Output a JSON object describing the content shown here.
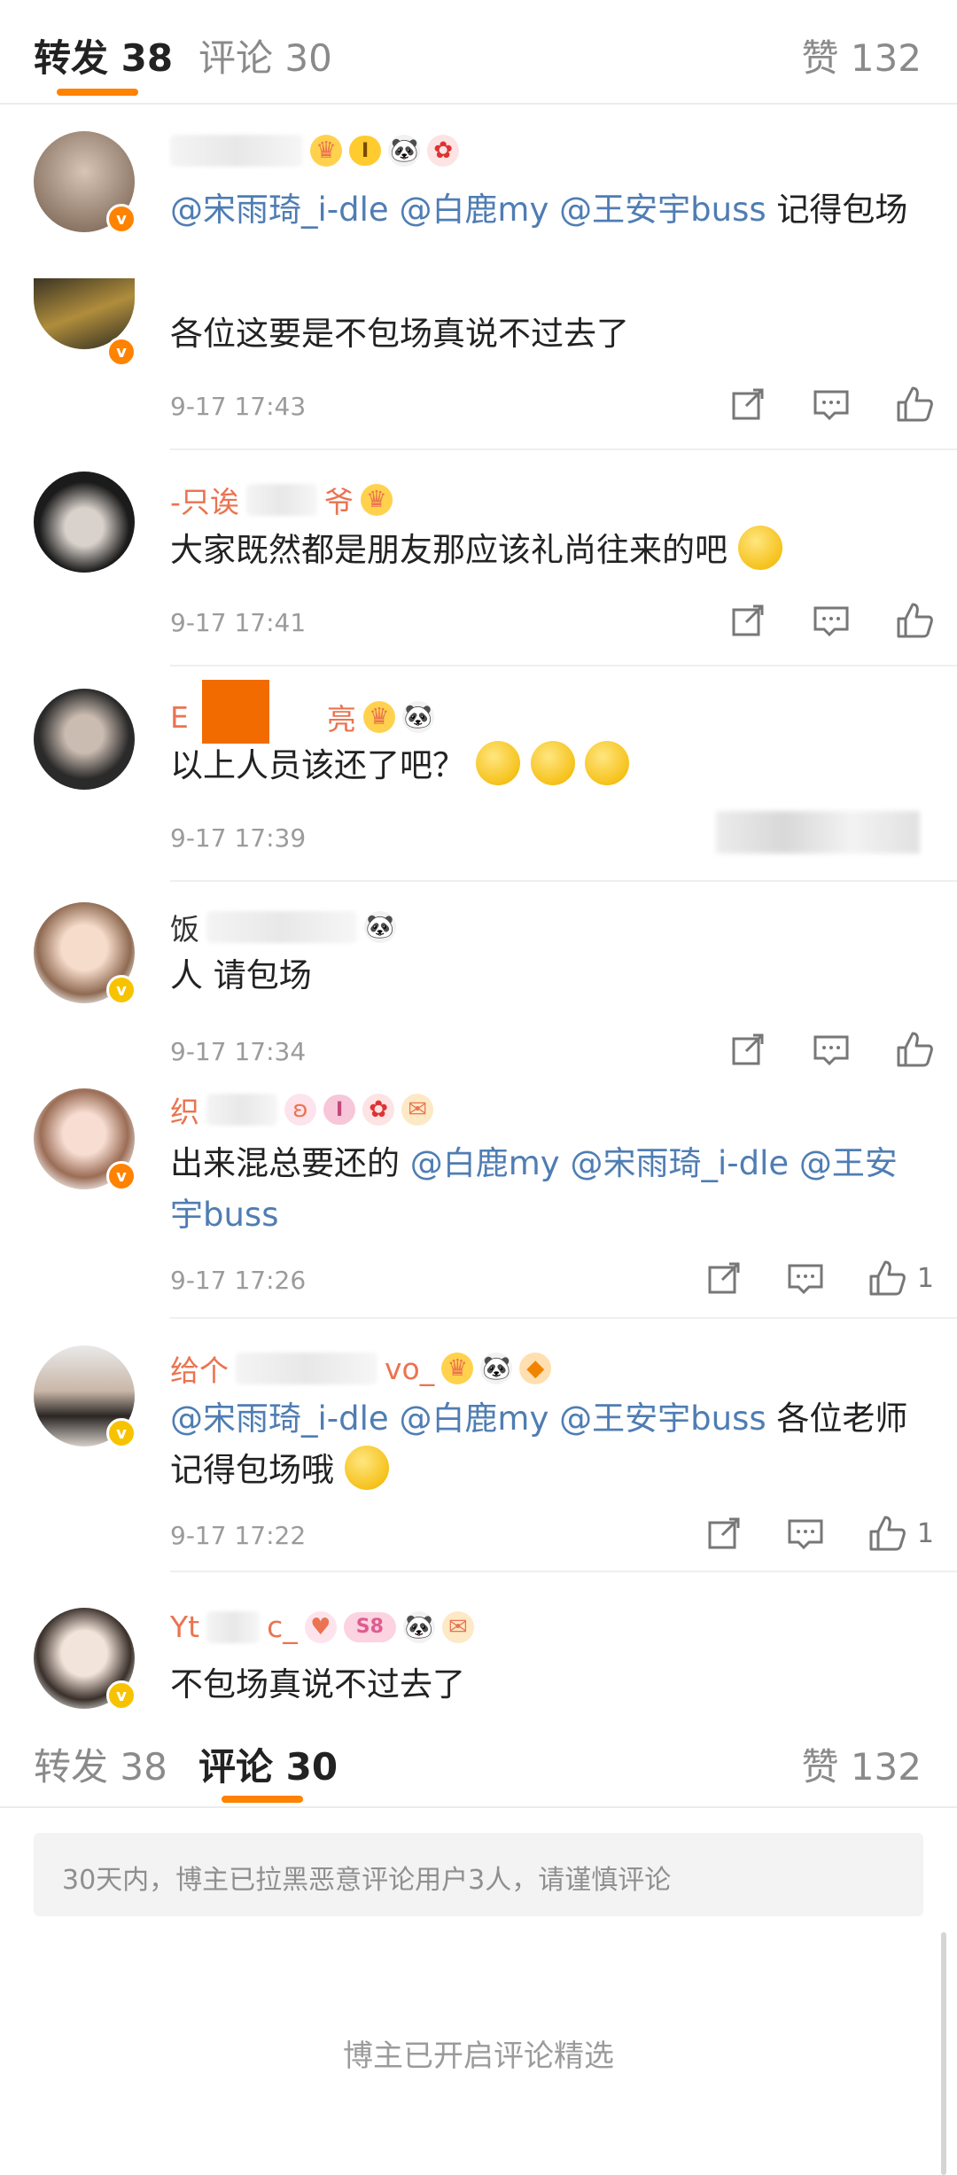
{
  "top_tabs": {
    "repost": "转发 38",
    "comment": "评论 30",
    "likes": "赞 132"
  },
  "comments": [
    {
      "name": "",
      "text_mentions": [
        "@宋雨琦_i-dle",
        "@白鹿my",
        "@王安宇buss"
      ],
      "text_tail": "记得包场",
      "time": "",
      "badge": "orange"
    },
    {
      "name": "",
      "text": "各位这要是不包场真说不过去了",
      "time": "9-17 17:43",
      "badge": "orange"
    },
    {
      "name_a": "-只诶",
      "name_b": "爷",
      "text": "大家既然都是朋友那应该礼尚往来的吧",
      "time": "9-17 17:41"
    },
    {
      "name_a": "E",
      "name_b": "亮",
      "text": "以上人员该还了吧？",
      "time": "9-17 17:39"
    },
    {
      "name_a": "饭",
      "text": "人 请包场",
      "time": "9-17 17:34",
      "badge": "yellow"
    },
    {
      "name_a": "织",
      "text_head": "出来混总要还的",
      "text_mentions": [
        "@白鹿my",
        "@宋雨琦_i-dle",
        "@王安宇buss"
      ],
      "time": "9-17 17:26",
      "like_count": "1",
      "badge": "orange"
    },
    {
      "name_a": "给个",
      "name_b": "vo_",
      "text_mentions": [
        "@宋雨琦_i-dle",
        "@白鹿my",
        "@王安宇buss"
      ],
      "text_tail": "各位老师记得包场哦",
      "time": "9-17 17:22",
      "like_count": "1",
      "badge": "yellow"
    },
    {
      "name_a": "Yt",
      "name_b": "c_",
      "text": "不包场真说不过去了",
      "level": "S8",
      "badge": "yellow"
    }
  ],
  "bottom_tabs": {
    "repost": "转发 38",
    "comment": "评论 30",
    "likes": "赞 132"
  },
  "level_badges": {
    "first": "I",
    "sixth": "I",
    "eighth": "S8"
  },
  "notice": "30天内，博主已拉黑恶意评论用户3人，请谨慎评论",
  "footer": "博主已开启评论精选",
  "icons": [
    "share-icon",
    "comment-icon",
    "like-icon",
    "panda-icon",
    "crown-icon"
  ],
  "colors": {
    "accent": "#ff8200",
    "mention": "#4f7db3",
    "nickname": "#eb7350"
  }
}
